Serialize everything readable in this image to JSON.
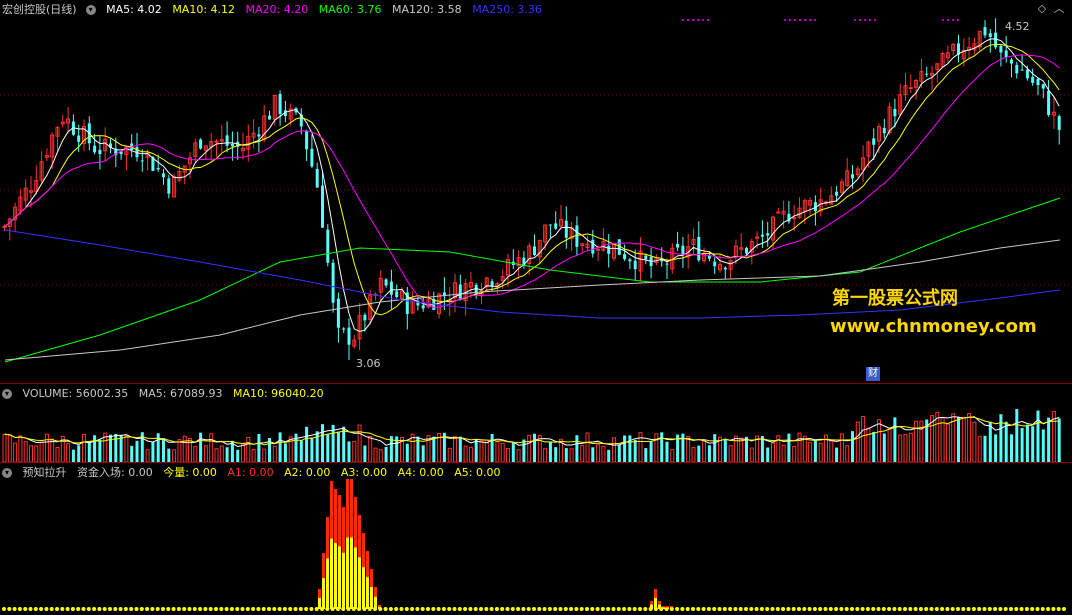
{
  "price_panel": {
    "title": "宏创控股(日线)",
    "ma_legends": [
      {
        "label": "MA5: 4.02",
        "color": "#ffffff"
      },
      {
        "label": "MA10: 4.12",
        "color": "#ffff00"
      },
      {
        "label": "MA20: 4.20",
        "color": "#ff00ff"
      },
      {
        "label": "MA60: 3.76",
        "color": "#00ff00"
      },
      {
        "label": "MA120: 3.58",
        "color": "#c8c8c8"
      },
      {
        "label": "MA250: 3.36",
        "color": "#3333ff"
      }
    ],
    "high_label": "4.52",
    "low_label": "3.06",
    "finance_badge": "财"
  },
  "watermark": {
    "line1": "第一股票公式网",
    "line2": "www.chnmoney.com"
  },
  "volume_panel": {
    "legends": [
      {
        "label": "VOLUME: 56002.35",
        "color": "#c8c8c8"
      },
      {
        "label": "MA5: 67089.93",
        "color": "#c8c8c8"
      },
      {
        "label": "MA10: 96040.20",
        "color": "#ffff00"
      }
    ]
  },
  "indicator_panel": {
    "legends": [
      {
        "label": "预知拉升",
        "color": "#c8c8c8"
      },
      {
        "label": "资金入场: 0.00",
        "color": "#c8c8c8"
      },
      {
        "label": "今量: 0.00",
        "color": "#ffff00"
      },
      {
        "label": "A1: 0.00",
        "color": "#ff3030"
      },
      {
        "label": "A2: 0.00",
        "color": "#ffff00"
      },
      {
        "label": "A3: 0.00",
        "color": "#ffff00"
      },
      {
        "label": "A4: 0.00",
        "color": "#ffff00"
      },
      {
        "label": "A5: 0.00",
        "color": "#ffff00"
      }
    ]
  },
  "colors": {
    "up": "#ff3030",
    "down": "#54ffff",
    "grid": "#8b0000",
    "background": "#000000"
  },
  "chart_data": {
    "type": "candlestick",
    "series": [
      "MA5",
      "MA10",
      "MA20",
      "MA60",
      "MA120",
      "MA250"
    ],
    "price_high": 4.52,
    "price_low": 3.06,
    "volume_ma5": 67089.93,
    "volume_ma10": 96040.2,
    "volume_last": 56002.35
  }
}
